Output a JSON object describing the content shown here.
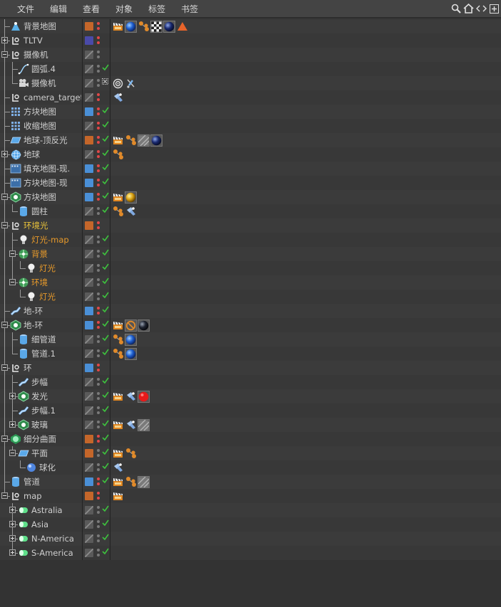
{
  "menu": [
    "文件",
    "编辑",
    "查看",
    "对象",
    "标签",
    "书签"
  ],
  "toolbar_icons": [
    "search-icon",
    "home-icon",
    "arrows-icon",
    "panel-toggle-icon"
  ],
  "colors": {
    "layer_orange": "#c4662a",
    "layer_blue": "#4a8fd6",
    "layer_purple": "#4a4aa8",
    "dot_red": "#e04848",
    "dot_grey": "#7a7a7a",
    "check_green": "#3ec23e",
    "label_orange": "#e89a2a",
    "label_yellow": "#e8c23a"
  },
  "rows": [
    {
      "label": "背景地图",
      "depth": 0,
      "expander": false,
      "icon": "sky-icon",
      "layer": "orange",
      "dots": [
        "red",
        "red"
      ],
      "check": "",
      "tags": [
        "clapper-icon",
        "blue-sphere-material-icon",
        "orange-dots-icon",
        "checker-material-icon",
        "dark-sphere-material-icon",
        "warning-triangle-icon"
      ],
      "style": ""
    },
    {
      "label": "TLTV",
      "depth": 0,
      "expander": true,
      "icon": "null-icon",
      "layer": "purple",
      "dots": [
        "red",
        "red"
      ],
      "check": "",
      "tags": [],
      "style": ""
    },
    {
      "label": "摄像机",
      "depth": 0,
      "expander": "open",
      "icon": "null-icon",
      "layer": "none",
      "dots": [
        "grey",
        "grey"
      ],
      "check": "",
      "tags": [],
      "style": ""
    },
    {
      "label": "圆弧.4",
      "depth": 1,
      "expander": false,
      "icon": "spline-icon",
      "layer": "none",
      "dots": [
        "grey",
        "grey"
      ],
      "check": "ok",
      "tags": [],
      "style": ""
    },
    {
      "label": "摄像机",
      "depth": 1,
      "expander": false,
      "icon": "camera-icon",
      "layer": "none",
      "dots": [
        "grey",
        "grey"
      ],
      "check": "x",
      "tags": [
        "target-icon",
        "protection-icon"
      ],
      "style": ""
    },
    {
      "label": "camera_target",
      "depth": 0,
      "expander": false,
      "icon": "null-icon",
      "layer": "none",
      "dots": [
        "red",
        "red"
      ],
      "check": "",
      "tags": [
        "phong-icon"
      ],
      "style": ""
    },
    {
      "label": "方块地图",
      "depth": 0,
      "expander": false,
      "icon": "grid-icon",
      "layer": "blue",
      "dots": [
        "red",
        "red"
      ],
      "check": "ok",
      "tags": [],
      "style": ""
    },
    {
      "label": "收缩地图",
      "depth": 0,
      "expander": false,
      "icon": "grid-icon",
      "layer": "none",
      "dots": [
        "red",
        "red"
      ],
      "check": "ok",
      "tags": [],
      "style": ""
    },
    {
      "label": "地球-顶反光",
      "depth": 0,
      "expander": false,
      "icon": "plane-icon",
      "layer": "orange",
      "dots": [
        "red",
        "red"
      ],
      "check": "ok",
      "tags": [
        "clapper-icon",
        "orange-dots-icon",
        "grey-material-icon",
        "dark-sphere-material-icon"
      ],
      "style": ""
    },
    {
      "label": "地球",
      "depth": 0,
      "expander": true,
      "icon": "sphere-icon",
      "layer": "none",
      "dots": [
        "red",
        "red"
      ],
      "check": "ok",
      "tags": [
        "orange-dots-icon"
      ],
      "style": ""
    },
    {
      "label": "填充地图-现.",
      "depth": 0,
      "expander": false,
      "icon": "film-icon",
      "layer": "blue",
      "dots": [
        "red",
        "red"
      ],
      "check": "ok",
      "tags": [],
      "style": ""
    },
    {
      "label": "方块地图-现",
      "depth": 0,
      "expander": false,
      "icon": "film-icon",
      "layer": "blue",
      "dots": [
        "red",
        "red"
      ],
      "check": "ok",
      "tags": [],
      "style": ""
    },
    {
      "label": "方块地图",
      "depth": 0,
      "expander": "open",
      "icon": "cloner-icon",
      "layer": "blue",
      "dots": [
        "red",
        "red"
      ],
      "check": "ok",
      "tags": [
        "clapper-icon",
        "gold-sphere-material-icon"
      ],
      "style": ""
    },
    {
      "label": "圆柱",
      "depth": 1,
      "expander": false,
      "icon": "cylinder-icon",
      "layer": "none",
      "dots": [
        "grey",
        "grey"
      ],
      "check": "ok",
      "tags": [
        "orange-dots-icon",
        "phong-icon"
      ],
      "style": ""
    },
    {
      "label": "环境光",
      "depth": 0,
      "expander": "open",
      "icon": "null-icon",
      "layer": "orange",
      "dots": [
        "red",
        "red"
      ],
      "check": "",
      "tags": [],
      "style": "yellow"
    },
    {
      "label": "灯光-map",
      "depth": 1,
      "expander": false,
      "icon": "light-icon",
      "layer": "none",
      "dots": [
        "grey",
        "grey"
      ],
      "check": "ok",
      "tags": [],
      "style": "orange"
    },
    {
      "label": "背景",
      "depth": 1,
      "expander": "open",
      "icon": "environment-icon",
      "layer": "none",
      "dots": [
        "grey",
        "grey"
      ],
      "check": "ok",
      "tags": [],
      "style": "orange"
    },
    {
      "label": "灯光",
      "depth": 2,
      "expander": false,
      "icon": "light-icon",
      "layer": "none",
      "dots": [
        "grey",
        "grey"
      ],
      "check": "ok",
      "tags": [],
      "style": "orange"
    },
    {
      "label": "环境",
      "depth": 1,
      "expander": "open",
      "icon": "environment-icon",
      "layer": "none",
      "dots": [
        "grey",
        "grey"
      ],
      "check": "ok",
      "tags": [],
      "style": "orange"
    },
    {
      "label": "灯光",
      "depth": 2,
      "expander": false,
      "icon": "light-icon",
      "layer": "none",
      "dots": [
        "grey",
        "grey"
      ],
      "check": "ok",
      "tags": [],
      "style": "orange"
    },
    {
      "label": "地-环",
      "depth": 0,
      "expander": false,
      "icon": "sweep-icon",
      "layer": "blue",
      "dots": [
        "red",
        "red"
      ],
      "check": "ok",
      "tags": [],
      "style": ""
    },
    {
      "label": "地-环",
      "depth": 0,
      "expander": "open",
      "icon": "cloner-icon",
      "layer": "blue",
      "dots": [
        "red",
        "red"
      ],
      "check": "ok",
      "tags": [
        "clapper-icon",
        "no-entry-icon",
        "black-sphere-material-icon"
      ],
      "style": ""
    },
    {
      "label": "细管道",
      "depth": 1,
      "expander": false,
      "icon": "cylinder-icon",
      "layer": "none",
      "dots": [
        "grey",
        "grey"
      ],
      "check": "ok",
      "tags": [
        "orange-dots-icon",
        "blue-sphere-material-icon"
      ],
      "style": ""
    },
    {
      "label": "管道.1",
      "depth": 1,
      "expander": false,
      "icon": "cylinder-icon",
      "layer": "none",
      "dots": [
        "grey",
        "grey"
      ],
      "check": "ok",
      "tags": [
        "orange-dots-icon",
        "blue-sphere-material-icon"
      ],
      "style": ""
    },
    {
      "label": "环",
      "depth": 0,
      "expander": "open",
      "icon": "null-icon",
      "layer": "blue",
      "dots": [
        "red",
        "red"
      ],
      "check": "",
      "tags": [],
      "style": ""
    },
    {
      "label": "步幅",
      "depth": 1,
      "expander": false,
      "icon": "sweep-icon",
      "layer": "none",
      "dots": [
        "grey",
        "grey"
      ],
      "check": "ok",
      "tags": [],
      "style": ""
    },
    {
      "label": "发光",
      "depth": 1,
      "expander": true,
      "icon": "cloner-icon",
      "layer": "none",
      "dots": [
        "grey",
        "grey"
      ],
      "check": "ok",
      "tags": [
        "clapper-icon",
        "phong-icon",
        "red-material-icon"
      ],
      "style": ""
    },
    {
      "label": "步幅.1",
      "depth": 1,
      "expander": false,
      "icon": "sweep-icon",
      "layer": "none",
      "dots": [
        "grey",
        "grey"
      ],
      "check": "ok",
      "tags": [],
      "style": ""
    },
    {
      "label": "玻璃",
      "depth": 1,
      "expander": true,
      "icon": "cloner-icon",
      "layer": "none",
      "dots": [
        "grey",
        "grey"
      ],
      "check": "ok",
      "tags": [
        "clapper-icon",
        "phong-icon",
        "grey-material-icon"
      ],
      "style": ""
    },
    {
      "label": "细分曲面",
      "depth": 0,
      "expander": "open",
      "icon": "subdivision-icon",
      "layer": "orange",
      "dots": [
        "red",
        "red"
      ],
      "check": "ok",
      "tags": [],
      "style": ""
    },
    {
      "label": "平面",
      "depth": 1,
      "expander": "open",
      "icon": "plane-icon",
      "layer": "orange",
      "dots": [
        "grey",
        "grey"
      ],
      "check": "ok",
      "tags": [
        "clapper-icon",
        "orange-dots-icon"
      ],
      "style": ""
    },
    {
      "label": "球化",
      "depth": 2,
      "expander": false,
      "icon": "spherify-icon",
      "layer": "none",
      "dots": [
        "grey",
        "grey"
      ],
      "check": "ok",
      "tags": [
        "phong-icon"
      ],
      "style": ""
    },
    {
      "label": "管道",
      "depth": 0,
      "expander": false,
      "icon": "cylinder-icon",
      "layer": "blue",
      "dots": [
        "red",
        "red"
      ],
      "check": "ok",
      "tags": [
        "clapper-icon",
        "orange-dots-icon",
        "grey-material-icon"
      ],
      "style": ""
    },
    {
      "label": "map",
      "depth": 0,
      "expander": "open",
      "icon": "null-icon",
      "layer": "orange",
      "dots": [
        "red",
        "red"
      ],
      "check": "",
      "tags": [
        "clapper-icon"
      ],
      "style": ""
    },
    {
      "label": "Astralia",
      "depth": 1,
      "expander": true,
      "icon": "capsule-icon",
      "layer": "none",
      "dots": [
        "grey",
        "grey"
      ],
      "check": "ok",
      "tags": [],
      "style": ""
    },
    {
      "label": "Asia",
      "depth": 1,
      "expander": true,
      "icon": "capsule-icon",
      "layer": "none",
      "dots": [
        "grey",
        "grey"
      ],
      "check": "ok",
      "tags": [],
      "style": ""
    },
    {
      "label": "N-America",
      "depth": 1,
      "expander": true,
      "icon": "capsule-icon",
      "layer": "none",
      "dots": [
        "grey",
        "grey"
      ],
      "check": "ok",
      "tags": [],
      "style": ""
    },
    {
      "label": "S-America",
      "depth": 1,
      "expander": true,
      "icon": "capsule-icon",
      "layer": "none",
      "dots": [
        "grey",
        "grey"
      ],
      "check": "ok",
      "tags": [],
      "style": ""
    }
  ]
}
